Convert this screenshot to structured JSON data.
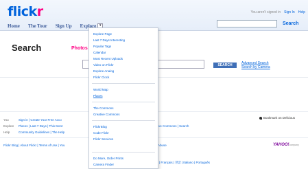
{
  "header": {
    "logo_part1": "flick",
    "logo_part2": "r",
    "signin_status": "You aren't signed in",
    "signin_link": "Sign In",
    "help_link": "Help"
  },
  "nav": {
    "items": [
      {
        "label": "Home"
      },
      {
        "label": "The Tour"
      },
      {
        "label": "Sign Up"
      },
      {
        "label": "Explore"
      }
    ],
    "explore_toggle_glyph": "▾"
  },
  "search_top": {
    "button_label": "Search"
  },
  "page": {
    "title": "Search",
    "tab_label": "Photos",
    "search_button": "SEARCH",
    "advanced_search": "Advanced Search",
    "search_by_camera": "Search by Camera"
  },
  "explore_menu": {
    "group1": [
      "Explore Page",
      "Last 7 Days Interesting",
      "Popular Tags",
      "Calendar",
      "Most Recent Uploads",
      "Video on Flickr",
      "Explore Analog",
      "Flickr Clock"
    ],
    "group2": [
      "World Map",
      "Places"
    ],
    "group3": [
      "The Commons",
      "Creative Commons"
    ],
    "group4": [
      "FlickrBlog",
      "Code Flickr",
      "Flickr Services"
    ],
    "group5": [
      "Do More, Order Prints",
      "Camera Finder"
    ]
  },
  "footer": {
    "you_label": "You",
    "you_links": "Sign in | Create Your Free Acco",
    "explore_label": "Explore",
    "explore_links": "Places | Last 7 Days | This Mont",
    "explore_tail": "ive Commons | Search",
    "help_label": "Help",
    "help_links": "Community Guidelines | The Help",
    "links_row": "Flickr Blog | About Flickr | Terms of Use | You",
    "links_tail": "Abuse",
    "languages": "| Français | 한글 | Italiano | Português",
    "bookmark": "Bookmark on Delicious",
    "yahoo_brand": "YAHOO!",
    "yahoo_suffix": "company"
  }
}
